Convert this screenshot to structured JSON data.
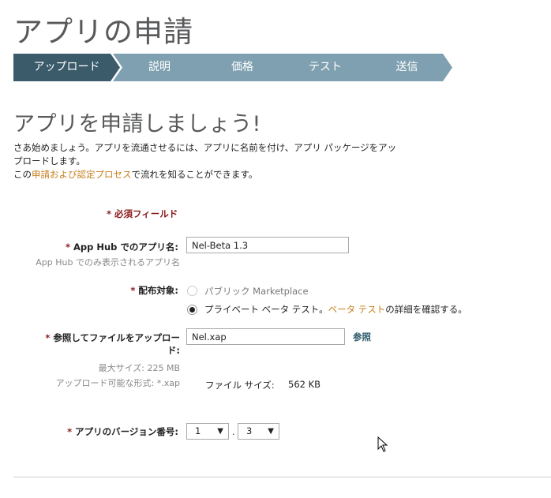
{
  "page_title": "アプリの申請",
  "steps": [
    {
      "label": "アップロード"
    },
    {
      "label": "説明"
    },
    {
      "label": "価格"
    },
    {
      "label": "テスト"
    },
    {
      "label": "送信"
    }
  ],
  "headline": "アプリを申請しましょう!",
  "intro": {
    "line1": "さあ始めましょう。アプリを流通させるには、アプリに名前を付け、アプリ パッケージをアッ",
    "line2": "プロードします。",
    "line3_pre": "この",
    "line3_link": "申請および認定プロセス",
    "line3_post": "で流れを知ることができます。"
  },
  "required_note": "* 必須フィールド",
  "app_name": {
    "label": "App Hub でのアプリ名:",
    "hint": "App Hub でのみ表示されるアプリ名",
    "value": "Nel-Beta 1.3"
  },
  "distribution": {
    "label": "配布対象:",
    "option_public": "パブリック Marketplace",
    "option_private_pre": "プライベート ベータ テスト。",
    "option_private_link": "ベータ テスト",
    "option_private_post": "の詳細を確認する。"
  },
  "upload": {
    "label_line1": "参照してファイルをアップロー",
    "label_line2": "ド:",
    "value": "Nel.xap",
    "browse": "参照",
    "max_size": "最大サイズ: 225 MB",
    "formats": "アップロード可能な形式: *.xap",
    "file_size_label": "ファイル サイズ:",
    "file_size_value": "562 KB"
  },
  "version": {
    "label": "アプリのバージョン番号:",
    "major": "1",
    "minor": "3",
    "separator": "."
  },
  "colors": {
    "step_active": "#3b5a6a",
    "step_inactive": "#7fa0b0",
    "required": "#8b1a1a",
    "link": "#c47f1b"
  }
}
